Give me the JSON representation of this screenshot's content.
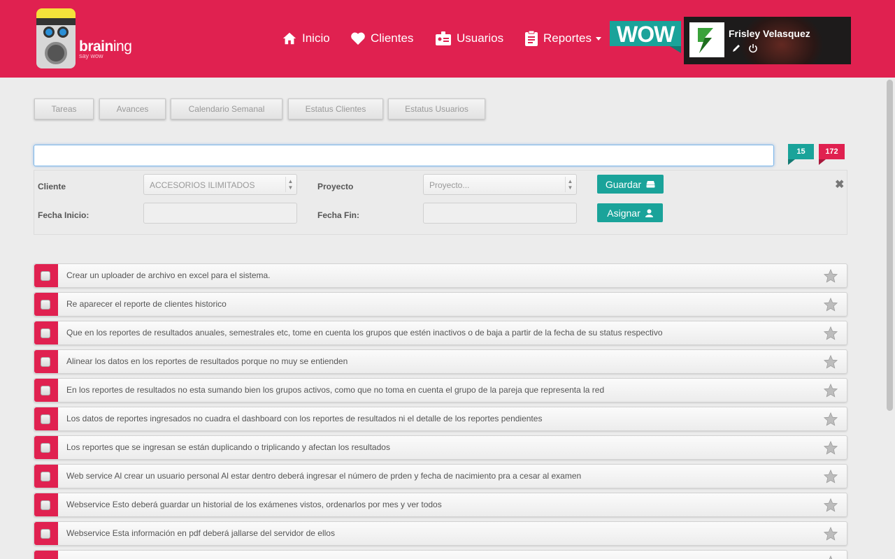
{
  "brand": {
    "name_bold": "brain",
    "name_light": "ing",
    "tagline": "say wow"
  },
  "nav": [
    {
      "label": "Inicio",
      "icon": "home-icon"
    },
    {
      "label": "Clientes",
      "icon": "heart-icon"
    },
    {
      "label": "Usuarios",
      "icon": "id-card-icon"
    },
    {
      "label": "Reportes",
      "icon": "clipboard-icon"
    }
  ],
  "wow_label": "WOW",
  "user": {
    "name": "Frisley Velasquez"
  },
  "tabs": [
    "Tareas",
    "Avances",
    "Calendario Semanal",
    "Estatus Clientes",
    "Estatus Usuarios"
  ],
  "search": {
    "value": "",
    "placeholder": ""
  },
  "badges": {
    "green": "15",
    "red": "172"
  },
  "form": {
    "cliente_label": "Cliente",
    "cliente_value": "ACCESORIOS ILIMITADOS",
    "proyecto_label": "Proyecto",
    "proyecto_placeholder": "Proyecto...",
    "fecha_inicio_label": "Fecha Inicio:",
    "fecha_fin_label": "Fecha Fin:",
    "guardar_label": "Guardar",
    "asignar_label": "Asignar"
  },
  "tasks": [
    "Crear un uploader de archivo en excel para el sistema.",
    "Re aparecer el reporte de clientes historico",
    "Que en los reportes de resultados anuales, semestrales etc, tome en cuenta los grupos que estén inactivos o de baja a partir de la fecha de su status respectivo",
    "Alinear los datos en los reportes de resultados porque no muy se entienden",
    "En los reportes de resultados no esta sumando bien los grupos activos, como que no toma en cuenta el grupo de la pareja que representa la red",
    "Los datos de reportes ingresados no cuadra el dashboard con los reportes de resultados ni el detalle de los reportes pendientes",
    "Los reportes que se ingresan se están duplicando o triplicando y afectan los resultados",
    "Web service Al crear un usuario personal Al estar dentro deberá ingresar el número de prden y fecha de nacimiento pra a cesar al examen",
    "Webservice Esto deberá guardar un historial de los exámenes vistos, ordenarlos por mes y ver todos",
    "Webservice Esta información en pdf deberá jallarse del servidor de ellos"
  ],
  "colors": {
    "brand": "#e02150",
    "accent": "#1aa39a"
  }
}
